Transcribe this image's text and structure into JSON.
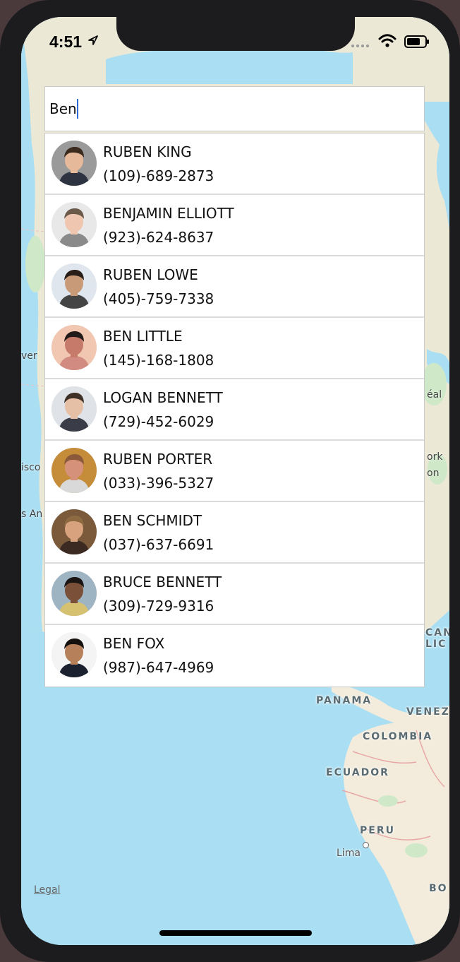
{
  "status_bar": {
    "time": "4:51"
  },
  "search": {
    "value": "Ben"
  },
  "results": [
    {
      "name": "RUBEN KING",
      "phone": "(109)-689-2873",
      "skin": "#e6b99a",
      "hair": "#3b2a1e",
      "shirt": "#2d3340",
      "bg": "#9a9a9a"
    },
    {
      "name": "BENJAMIN ELLIOTT",
      "phone": "(923)-624-8637",
      "skin": "#efc7b1",
      "hair": "#6b5a4a",
      "shirt": "#8a8a8a",
      "bg": "#e8e8e8"
    },
    {
      "name": "RUBEN LOWE",
      "phone": "(405)-759-7338",
      "skin": "#c89a78",
      "hair": "#2a1e18",
      "shirt": "#444",
      "bg": "#dfe6ee"
    },
    {
      "name": "BEN LITTLE",
      "phone": "(145)-168-1808",
      "skin": "#c57a6a",
      "hair": "#221a18",
      "shirt": "#d18b80",
      "bg": "#f2c7b2"
    },
    {
      "name": "LOGAN BENNETT",
      "phone": "(729)-452-6029",
      "skin": "#e6c0a6",
      "hair": "#3e3026",
      "shirt": "#3a3d48",
      "bg": "#dfe3e8"
    },
    {
      "name": "RUBEN PORTER",
      "phone": "(033)-396-5327",
      "skin": "#d6917a",
      "hair": "#8a5a3a",
      "shirt": "#d9d9d9",
      "bg": "#c58c3a"
    },
    {
      "name": "BEN SCHMIDT",
      "phone": "(037)-637-6691",
      "skin": "#d9a27f",
      "hair": "#8e6a42",
      "shirt": "#3a2a22",
      "bg": "#7a5a3a"
    },
    {
      "name": "BRUCE BENNETT",
      "phone": "(309)-729-9316",
      "skin": "#7a5038",
      "hair": "#1a1412",
      "shirt": "#d6c170",
      "bg": "#9fb4c2"
    },
    {
      "name": "BEN FOX",
      "phone": "(987)-647-4969",
      "skin": "#b5805a",
      "hair": "#15110f",
      "shirt": "#1c2130",
      "bg": "#f4f4f4"
    }
  ],
  "map": {
    "labels": [
      "PANAMA",
      "VENEZU",
      "COLOMBIA",
      "ECUADOR",
      "PERU",
      "CAN",
      "LIC",
      "BO"
    ],
    "cities": [
      "Lima"
    ],
    "edge_text": [
      "ver",
      "éal",
      "ork",
      "on",
      "isco",
      "s An"
    ],
    "legal": "Legal"
  }
}
